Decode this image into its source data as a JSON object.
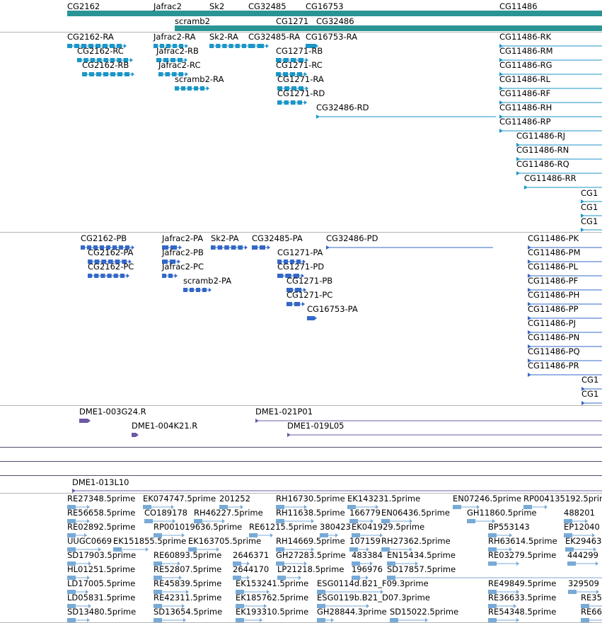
{
  "colors": {
    "gene_span": "#2a9494",
    "transcript": "#1b96c7",
    "protein": "#3468c8",
    "clone": "#6c58a4",
    "est": "#78aad7",
    "separator": "#b5b5b5",
    "dark_separator": "#4e4e6e"
  },
  "tracks": {
    "genes": [
      {
        "label": "CG2162"
      },
      {
        "label": "Jafrac2"
      },
      {
        "label": "scramb2"
      },
      {
        "label": "Sk2"
      },
      {
        "label": "CG32485"
      },
      {
        "label": "CG1271"
      },
      {
        "label": "CG16753"
      },
      {
        "label": "CG32486"
      },
      {
        "label": "CG11486"
      }
    ],
    "transcripts": [
      {
        "label": "CG2162-RA"
      },
      {
        "label": "CG2162-RC"
      },
      {
        "label": "CG2162-RB"
      },
      {
        "label": "Jafrac2-RA"
      },
      {
        "label": "Jafrac2-RB"
      },
      {
        "label": "Jafrac2-RC"
      },
      {
        "label": "scramb2-RA"
      },
      {
        "label": "Sk2-RA"
      },
      {
        "label": "CG32485-RA"
      },
      {
        "label": "CG16753-RA"
      },
      {
        "label": "CG1271-RB"
      },
      {
        "label": "CG1271-RC"
      },
      {
        "label": "CG1271-RA"
      },
      {
        "label": "CG1271-RD"
      },
      {
        "label": "CG32486-RD"
      },
      {
        "label": "CG11486-RK"
      },
      {
        "label": "CG11486-RM"
      },
      {
        "label": "CG11486-RG"
      },
      {
        "label": "CG11486-RL"
      },
      {
        "label": "CG11486-RF"
      },
      {
        "label": "CG11486-RH"
      },
      {
        "label": "CG11486-RP"
      },
      {
        "label": "CG11486-RJ"
      },
      {
        "label": "CG11486-RN"
      },
      {
        "label": "CG11486-RQ"
      },
      {
        "label": "CG11486-RR"
      },
      {
        "label": "CG1"
      },
      {
        "label": "CG1"
      },
      {
        "label": "CG1"
      }
    ],
    "proteins": [
      {
        "label": "CG2162-PB"
      },
      {
        "label": "CG2162-PA"
      },
      {
        "label": "CG2162-PC"
      },
      {
        "label": "Jafrac2-PA"
      },
      {
        "label": "Jafrac2-PB"
      },
      {
        "label": "Jafrac2-PC"
      },
      {
        "label": "scramb2-PA"
      },
      {
        "label": "Sk2-PA"
      },
      {
        "label": "CG32485-PA"
      },
      {
        "label": "CG32486-PD"
      },
      {
        "label": "CG1271-PA"
      },
      {
        "label": "CG1271-PD"
      },
      {
        "label": "CG1271-PB"
      },
      {
        "label": "CG1271-PC"
      },
      {
        "label": "CG16753-PA"
      },
      {
        "label": "CG11486-PK"
      },
      {
        "label": "CG11486-PM"
      },
      {
        "label": "CG11486-PL"
      },
      {
        "label": "CG11486-PF"
      },
      {
        "label": "CG11486-PH"
      },
      {
        "label": "CG11486-PP"
      },
      {
        "label": "CG11486-PJ"
      },
      {
        "label": "CG11486-PN"
      },
      {
        "label": "CG11486-PQ"
      },
      {
        "label": "CG11486-PR"
      },
      {
        "label": "CG1"
      },
      {
        "label": "CG1"
      }
    ],
    "clones": [
      {
        "label": "DME1-003G24.R"
      },
      {
        "label": "DME1-004K21.R"
      },
      {
        "label": "DME1-021P01"
      },
      {
        "label": "DME1-019L05"
      },
      {
        "label": "DME1-013L10"
      }
    ],
    "ests": [
      {
        "label": "RE27348.5prime"
      },
      {
        "label": "EK074747.5prime"
      },
      {
        "label": "201252"
      },
      {
        "label": "RH16730.5prime"
      },
      {
        "label": "EK143231.5prime"
      },
      {
        "label": "EN07246.5prime"
      },
      {
        "label": "RP004135192.5prime"
      },
      {
        "label": "RE56658.5prime"
      },
      {
        "label": "CO189178"
      },
      {
        "label": "RH46227.5prime"
      },
      {
        "label": "RH11638.5prime"
      },
      {
        "label": "166779"
      },
      {
        "label": "EN06436.5prime"
      },
      {
        "label": "GH11860.5prime"
      },
      {
        "label": "488201"
      },
      {
        "label": "RE02892.5prime"
      },
      {
        "label": "RP001019636.5prime"
      },
      {
        "label": "RE61215.5prime"
      },
      {
        "label": "380423"
      },
      {
        "label": "EK041929.5prime"
      },
      {
        "label": "BP553143"
      },
      {
        "label": "EP12040"
      },
      {
        "label": "UUGC0669"
      },
      {
        "label": "EK151855.5prime"
      },
      {
        "label": "EK163705.5prime"
      },
      {
        "label": "RH14669.5prime"
      },
      {
        "label": "107159"
      },
      {
        "label": "RH27362.5prime"
      },
      {
        "label": "RH63614.5prime"
      },
      {
        "label": "EK29463"
      },
      {
        "label": "SD17903.5prime"
      },
      {
        "label": "RE60893.5prime"
      },
      {
        "label": "2646371"
      },
      {
        "label": "GH27283.5prime"
      },
      {
        "label": "483384"
      },
      {
        "label": "EN15434.5prime"
      },
      {
        "label": "RE03279.5prime"
      },
      {
        "label": "444299"
      },
      {
        "label": "HL01251.5prime"
      },
      {
        "label": "RE52807.5prime"
      },
      {
        "label": "2644170"
      },
      {
        "label": "LP21218.5prime"
      },
      {
        "label": "196976"
      },
      {
        "label": "SD17857.5prime"
      },
      {
        "label": "LD17005.5prime"
      },
      {
        "label": "RE45839.5prime"
      },
      {
        "label": "EK153241.5prime"
      },
      {
        "label": "ESG0114d.B21_F09.3prime"
      },
      {
        "label": "RE49849.5prime"
      },
      {
        "label": "329509"
      },
      {
        "label": "LD05831.5prime"
      },
      {
        "label": "RE42311.5prime"
      },
      {
        "label": "EK185762.5prime"
      },
      {
        "label": "ESG0119b.B21_D07.3prime"
      },
      {
        "label": "RE36633.5prime"
      },
      {
        "label": "RE35"
      },
      {
        "label": "SD13480.5prime"
      },
      {
        "label": "SD13654.5prime"
      },
      {
        "label": "EK193310.5prime"
      },
      {
        "label": "GH28844.3prime"
      },
      {
        "label": "SD15022.5prime"
      },
      {
        "label": "RE54348.5prime"
      },
      {
        "label": "RE66"
      }
    ]
  }
}
